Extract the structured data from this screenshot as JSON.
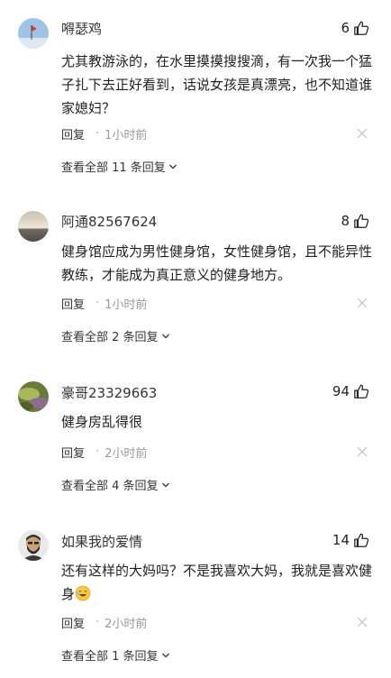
{
  "comments": [
    {
      "username": "嘚瑟鸡",
      "likes": "6",
      "text": "尤其教游泳的，在水里摸摸搜搜滴，有一次我一个猛子扎下去正好看到，话说女孩是真漂亮，也不知道谁家媳妇？",
      "reply_label": "回复",
      "time": "1小时前",
      "view_all": "查看全部 11 条回复"
    },
    {
      "username": "阿通82567624",
      "likes": "8",
      "text": "健身馆应成为男性健身馆，女性健身馆，且不能异性教练，才能成为真正意义的健身地方。",
      "reply_label": "回复",
      "time": "1小时前",
      "view_all": "查看全部 2 条回复"
    },
    {
      "username": "豪哥23329663",
      "likes": "94",
      "text": "健身房乱得很",
      "reply_label": "回复",
      "time": "2小时前",
      "view_all": "查看全部 4 条回复"
    },
    {
      "username": "如果我的爱情",
      "likes": "14",
      "text": "还有这样的大妈吗？不是我喜欢大妈，我就是喜欢健身",
      "reply_label": "回复",
      "time": "2小时前",
      "view_all": "查看全部 1 条回复"
    }
  ],
  "icons": {
    "like": "thumbs-up-icon",
    "close": "close-icon",
    "chevron": "chevron-down-icon",
    "emoji": "laughing-face-emoji"
  }
}
